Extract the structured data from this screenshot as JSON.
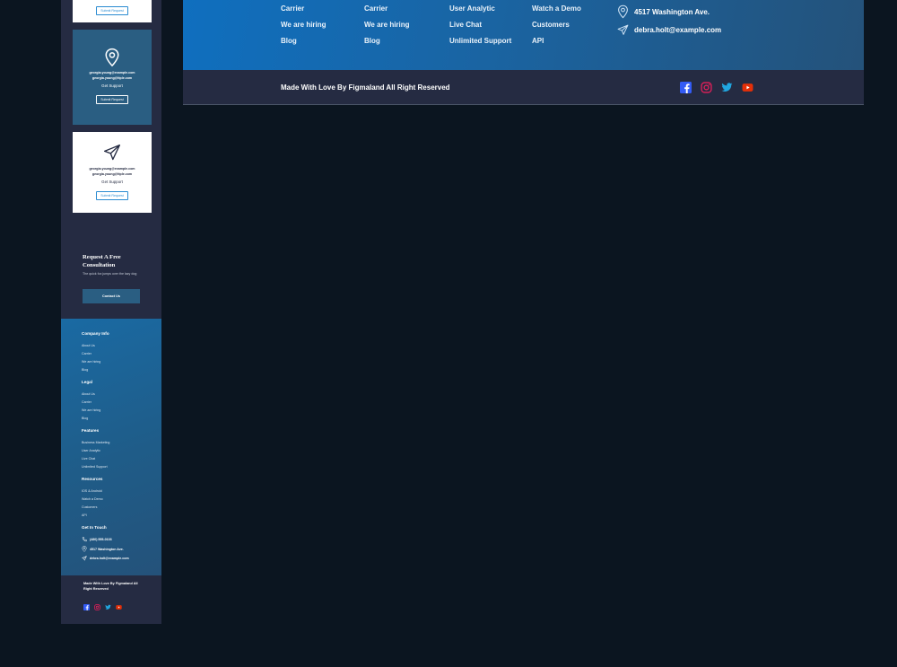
{
  "mobile": {
    "card1": {
      "button": "Submit Request"
    },
    "card2": {
      "email1": "georgia.young@example.com",
      "email2": "georgia.young@ttple.com",
      "support": "Get Support",
      "button": "Submit Request"
    },
    "card3": {
      "email1": "georgia.young@example.com",
      "email2": "georgia.young@ttple.com",
      "support": "Get Support",
      "button": "Submit Request"
    },
    "consult": {
      "title": "Request A Free Consultation",
      "desc": "The quick fox jumps over the lazy dog",
      "button": "Contact Us"
    },
    "footer": {
      "sections": [
        {
          "title": "Company Info",
          "links": [
            "About Us",
            "Carrier",
            "We are hiring",
            "Blog"
          ]
        },
        {
          "title": "Legal",
          "links": [
            "About Us",
            "Carrier",
            "We are hiring",
            "Blog"
          ]
        },
        {
          "title": "Features",
          "links": [
            "Business Marketing",
            "User Analytic",
            "Live Chat",
            "Unlimited Support"
          ]
        },
        {
          "title": "Resources",
          "links": [
            "IOS & Android",
            "Watch a Demo",
            "Customers",
            "API"
          ]
        }
      ],
      "touch_title": "Get In Touch",
      "phone": "(480) 555-0103",
      "address": "4517 Washington Ave.",
      "email": "debra.holt@example.com"
    },
    "bottom": {
      "copyright": "Made With Love By Figmaland All Right Reserved"
    }
  },
  "desktop": {
    "columns": [
      {
        "links": [
          "Carrier",
          "We are hiring",
          "Blog"
        ]
      },
      {
        "links": [
          "Carrier",
          "We are hiring",
          "Blog"
        ]
      },
      {
        "links": [
          "User Analytic",
          "Live Chat",
          "Unlimited Support"
        ]
      },
      {
        "links": [
          "Watch a Demo",
          "Customers",
          "API"
        ]
      }
    ],
    "address": "4517 Washington Ave.",
    "email": "debra.holt@example.com",
    "copyright": "Made With Love By Figmaland All Right Reserved"
  },
  "colors": {
    "page_bg": "#0b1520",
    "dark_navy": "#252b42",
    "accent_blue": "#2a8bd1",
    "facebook": "#335bf5",
    "instagram": "#e51f5a",
    "twitter": "#21a6df",
    "youtube": "#e42f08"
  },
  "icons": [
    "location-icon",
    "send-icon",
    "phone-icon",
    "facebook-icon",
    "instagram-icon",
    "twitter-icon",
    "youtube-icon"
  ]
}
